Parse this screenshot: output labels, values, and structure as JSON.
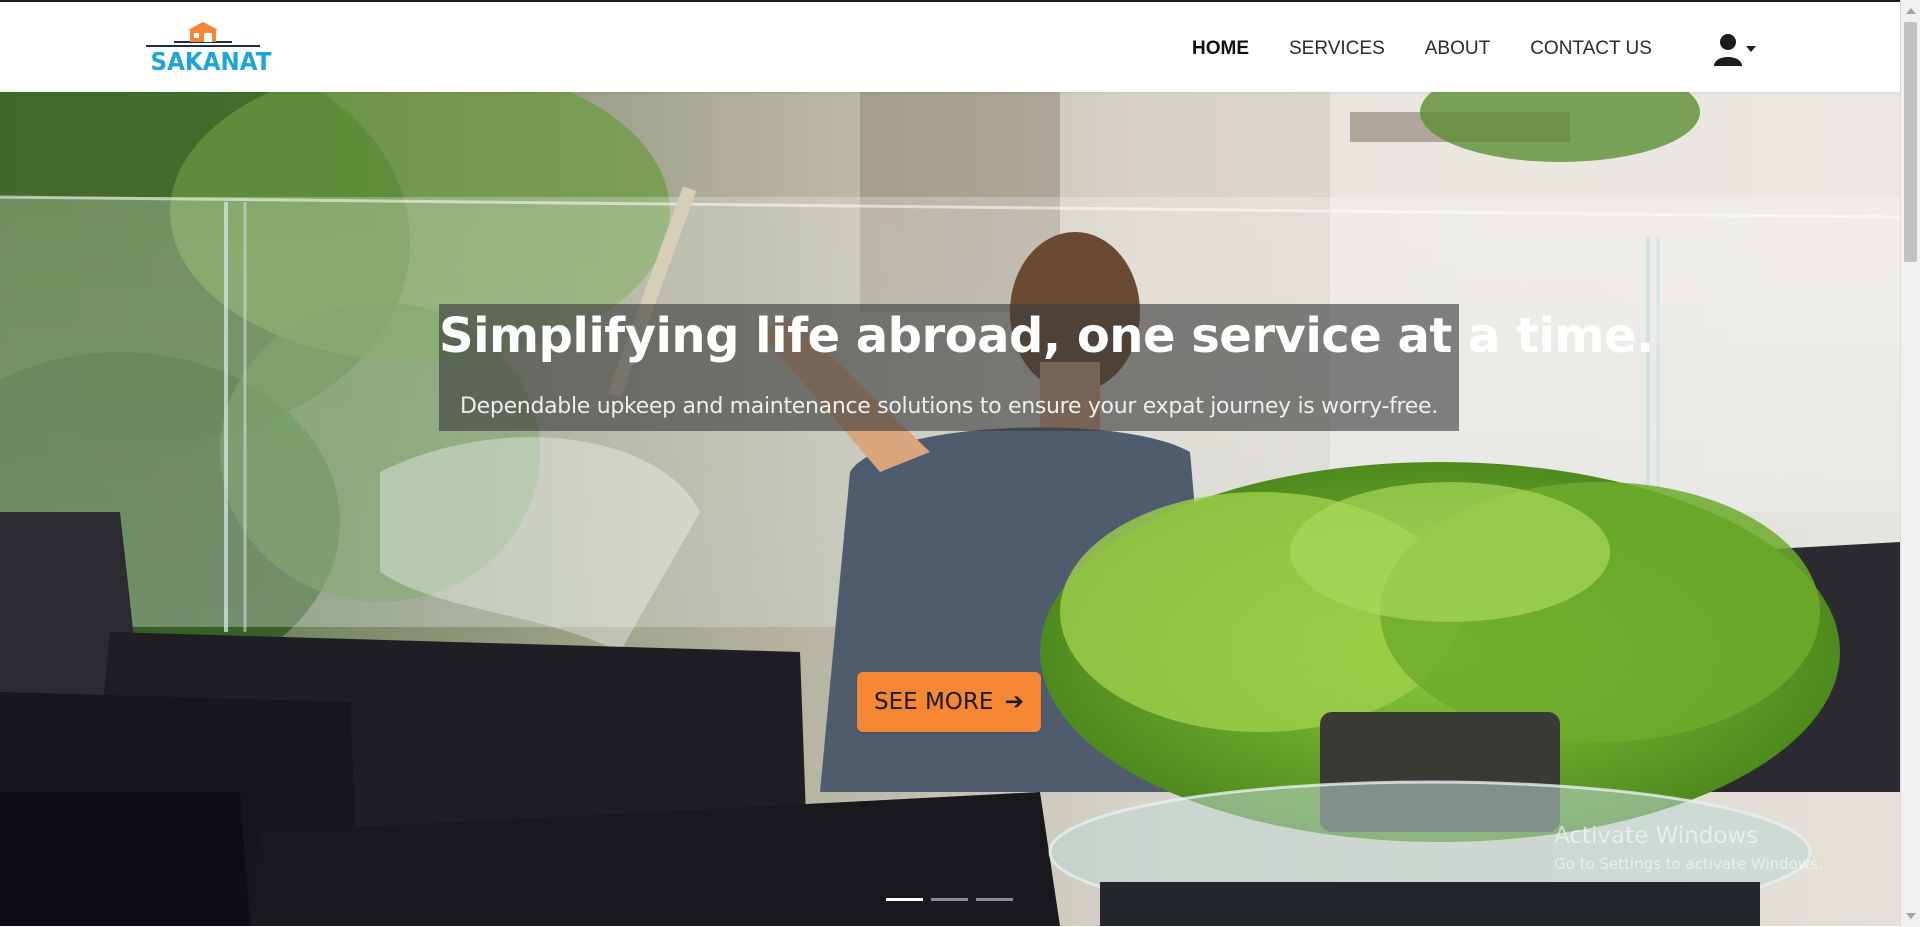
{
  "brand": {
    "name": "SAKANAT",
    "primary_color": "#1fa3dc",
    "accent_color": "#f58634"
  },
  "nav": {
    "items": [
      {
        "label": "HOME",
        "active": true
      },
      {
        "label": "SERVICES",
        "active": false
      },
      {
        "label": "ABOUT",
        "active": false
      },
      {
        "label": "CONTACT US",
        "active": false
      }
    ],
    "user_menu_icon": "user-icon",
    "user_menu_caret": "caret-down-icon"
  },
  "hero": {
    "title": "Simplifying life abroad, one service at a time.",
    "subtitle": "Dependable upkeep and maintenance solutions to ensure your expat journey is worry-free.",
    "cta": {
      "label": "SEE MORE",
      "icon": "arrow-right-icon"
    },
    "slides": 3,
    "active_slide": 1
  },
  "os_watermark": {
    "line1": "Activate Windows",
    "line2": "Go to Settings to activate Windows."
  }
}
